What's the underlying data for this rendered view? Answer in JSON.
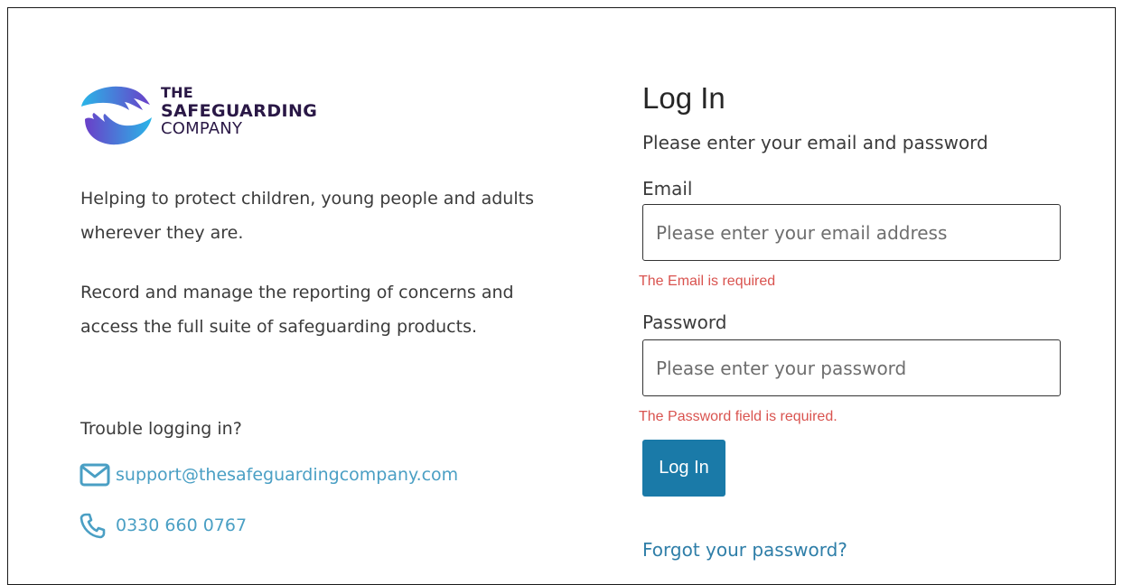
{
  "brand": {
    "line1": "THE",
    "line2": "SAFEGUARDING",
    "line3": "COMPANY",
    "colors": {
      "cyan": "#29b6e8",
      "purple": "#6a3fc8",
      "text": "#2a1846"
    }
  },
  "intro": {
    "p1": "Helping to protect children, young people and adults wherever they are.",
    "p2": "Record and manage the reporting of concerns and access the full suite of safeguarding products."
  },
  "support": {
    "trouble": "Trouble logging in?",
    "email": "support@thesafeguardingcompany.com",
    "email_icon": "envelope-icon",
    "phone": "0330 660 0767",
    "phone_icon": "phone-icon",
    "link_color": "#4a9fc4"
  },
  "login": {
    "title": "Log In",
    "subtitle": "Please enter your email and password",
    "email_label": "Email",
    "email_placeholder": "Please enter your email address",
    "email_value": "",
    "email_error": "The Email is required",
    "password_label": "Password",
    "password_placeholder": "Please enter your password",
    "password_value": "",
    "password_error": "The Password field is required.",
    "button": "Log In",
    "button_color": "#1a7aa8",
    "forgot": "Forgot your password?",
    "error_color": "#d9534f"
  }
}
